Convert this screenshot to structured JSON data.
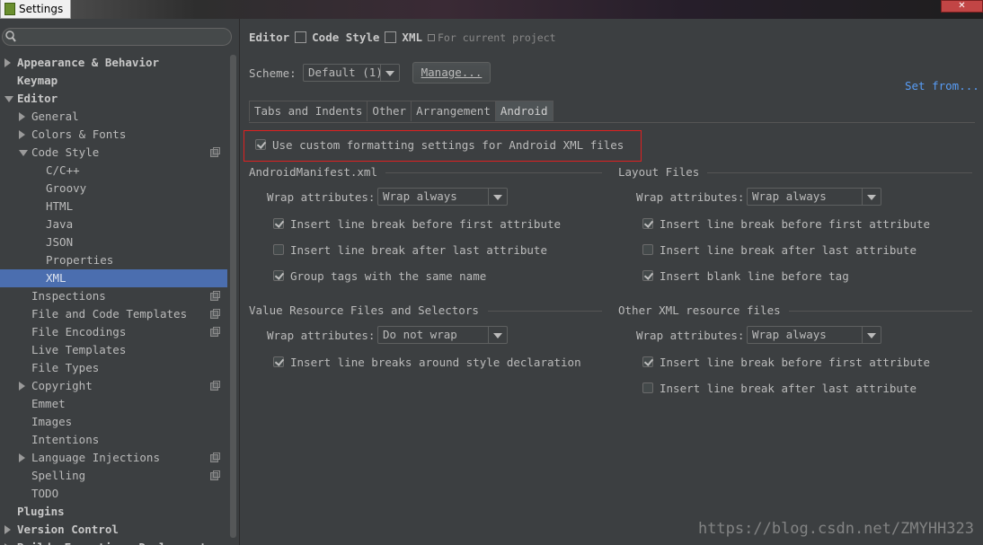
{
  "window": {
    "title": "Settings"
  },
  "search": {
    "placeholder": ""
  },
  "sidebar": {
    "items": [
      {
        "label": "Appearance & Behavior",
        "level": 0,
        "arrow": "right"
      },
      {
        "label": "Keymap",
        "level": 0
      },
      {
        "label": "Editor",
        "level": 0,
        "arrow": "down"
      },
      {
        "label": "General",
        "level": 1,
        "arrow": "right"
      },
      {
        "label": "Colors & Fonts",
        "level": 1,
        "arrow": "right"
      },
      {
        "label": "Code Style",
        "level": 1,
        "arrow": "down",
        "project": true
      },
      {
        "label": "C/C++",
        "level": 2
      },
      {
        "label": "Groovy",
        "level": 2
      },
      {
        "label": "HTML",
        "level": 2
      },
      {
        "label": "Java",
        "level": 2
      },
      {
        "label": "JSON",
        "level": 2
      },
      {
        "label": "Properties",
        "level": 2
      },
      {
        "label": "XML",
        "level": 2,
        "selected": true
      },
      {
        "label": "Inspections",
        "level": 1,
        "project": true
      },
      {
        "label": "File and Code Templates",
        "level": 1,
        "project": true
      },
      {
        "label": "File Encodings",
        "level": 1,
        "project": true
      },
      {
        "label": "Live Templates",
        "level": 1
      },
      {
        "label": "File Types",
        "level": 1
      },
      {
        "label": "Copyright",
        "level": 1,
        "arrow": "right",
        "project": true
      },
      {
        "label": "Emmet",
        "level": 1
      },
      {
        "label": "Images",
        "level": 1
      },
      {
        "label": "Intentions",
        "level": 1
      },
      {
        "label": "Language Injections",
        "level": 1,
        "arrow": "right",
        "project": true
      },
      {
        "label": "Spelling",
        "level": 1,
        "project": true
      },
      {
        "label": "TODO",
        "level": 1
      },
      {
        "label": "Plugins",
        "level": 0
      },
      {
        "label": "Version Control",
        "level": 0,
        "arrow": "right"
      },
      {
        "label": "Build, Execution, Deployment",
        "level": 0,
        "arrow": "right"
      }
    ]
  },
  "breadcrumb": {
    "part1": "Editor",
    "part2": "Code Style",
    "part3": "XML",
    "note": "For current project"
  },
  "scheme": {
    "label": "Scheme:",
    "value": "Default (1)",
    "manage_label": "Manage...",
    "set_from_label": "Set from..."
  },
  "tabs": [
    "Tabs and Indents",
    "Other",
    "Arrangement",
    "Android"
  ],
  "custom_settings": {
    "label": "Use custom formatting settings for Android XML files",
    "checked": true
  },
  "manifest": {
    "title": "AndroidManifest.xml",
    "wrap_label": "Wrap attributes:",
    "wrap_value": "Wrap always",
    "options": [
      {
        "label": "Insert line break before first attribute",
        "checked": true
      },
      {
        "label": "Insert line break after last attribute",
        "checked": false
      },
      {
        "label": "Group tags with the same name",
        "checked": true
      }
    ]
  },
  "layout": {
    "title": "Layout Files",
    "wrap_label": "Wrap attributes:",
    "wrap_value": "Wrap always",
    "options": [
      {
        "label": "Insert line break before first attribute",
        "checked": true
      },
      {
        "label": "Insert line break after last attribute",
        "checked": false
      },
      {
        "label": "Insert blank line before tag",
        "checked": true
      }
    ]
  },
  "values": {
    "title": "Value Resource Files and Selectors",
    "wrap_label": "Wrap attributes:",
    "wrap_value": "Do not wrap",
    "options": [
      {
        "label": "Insert line breaks around style declaration",
        "checked": true
      }
    ]
  },
  "other_xml": {
    "title": "Other XML resource files",
    "wrap_label": "Wrap attributes:",
    "wrap_value": "Wrap always",
    "options": [
      {
        "label": "Insert line break before first attribute",
        "checked": true
      },
      {
        "label": "Insert line break after last attribute",
        "checked": false
      }
    ]
  },
  "watermark": "https://blog.csdn.net/ZMYHH323",
  "colors": {
    "background": "#3c3f41",
    "selection": "#4b6eaf",
    "link": "#589df6",
    "highlight_border": "#e02020"
  }
}
